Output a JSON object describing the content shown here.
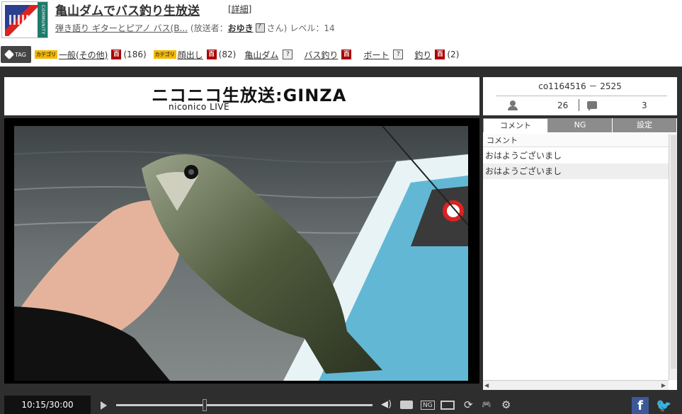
{
  "header": {
    "title": "亀山ダムでバス釣り生放送",
    "detail_label": "[詳細]",
    "community_label": "COMMUNITY",
    "community_name": "弾き語り ギターとピアノ バス(B...",
    "broadcaster_prefix": "(放送者：",
    "broadcaster_name": "おゆき",
    "broadcaster_suffix": "さん)",
    "level": "レベル：14"
  },
  "tags": {
    "label": "TAG",
    "category_badge": "カテゴリ",
    "items": [
      {
        "text": "一般(その他)",
        "count": "(186)"
      },
      {
        "text": "顔出し",
        "count": "(82)"
      },
      {
        "text": "亀山ダム"
      },
      {
        "text": "バス釣り"
      },
      {
        "text": "ボート"
      },
      {
        "text": "釣り",
        "count": "(2)"
      }
    ],
    "hyaku_label": "百",
    "q_label": "?"
  },
  "banner": {
    "line1": "ニコニコ生放送:GINZA",
    "line2": "niconico LIVE"
  },
  "stats": {
    "live_id": "co1164516 － 2525",
    "viewers": "26",
    "comments": "3"
  },
  "panel": {
    "tabs": [
      "コメント",
      "NG",
      "設定"
    ],
    "column_header": "コメント",
    "comments": [
      "おはようございまし",
      "おはようございまし"
    ]
  },
  "controls": {
    "time": "10:15/30:00",
    "seek_fraction": 0.337
  },
  "colors": {
    "bg_dark": "#2e2e2e",
    "facebook": "#3b5998",
    "twitter": "#1da1f2",
    "tag_badge": "#f5b800",
    "hyaku": "#aa0000"
  }
}
